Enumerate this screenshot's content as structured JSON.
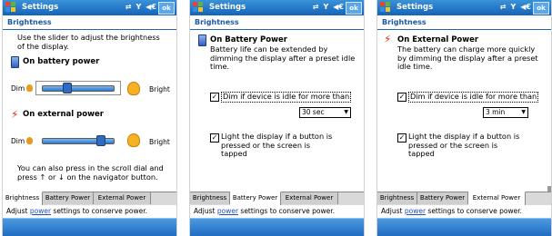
{
  "screens": [
    {
      "title": "Settings",
      "ok_label": "ok",
      "status_icons": [
        "⇄",
        "Y",
        "◀€"
      ],
      "page_heading": "Brightness",
      "instruction": "Use the slider to adjust the brightness of the display.",
      "battery_label": "On battery power",
      "external_label": "On external power",
      "dim_label": "Dim",
      "bright_label": "Bright",
      "battery_level": 0.33,
      "external_level": 0.85,
      "bottom_text": "You can also press in the scroll dial and press ↑ or ↓ on the navigator button.",
      "tabs": [
        "Brightness",
        "Battery Power",
        "External Power"
      ],
      "active_tab": 0,
      "footer_prefix": "Adjust ",
      "footer_link": "power",
      "footer_suffix": " settings to conserve power."
    },
    {
      "title": "Settings",
      "ok_label": "ok",
      "status_icons": [
        "⇄",
        "Y",
        "◀€"
      ],
      "page_heading": "Brightness",
      "section_title": "On Battery Power",
      "description": "Battery life can be extended by dimming the display after a preset idle time.",
      "dim_check_label": "Dim if device is idle for more than",
      "dim_checked": true,
      "timeout_value": "30 sec",
      "light_check_label": "Light the display if a button is pressed  or the screen is tapped",
      "light_checked": true,
      "tabs": [
        "Brightness",
        "Battery Power",
        "External Power"
      ],
      "active_tab": 1,
      "footer_prefix": "Adjust ",
      "footer_link": "power",
      "footer_suffix": " settings to conserve power."
    },
    {
      "title": "Settings",
      "ok_label": "ok",
      "status_icons": [
        "⇄",
        "Y",
        "◀€"
      ],
      "page_heading": "Brightness",
      "section_title": "On External Power",
      "description": "The battery can charge more quickly by dimming the display after a preset idle time.",
      "dim_check_label": "Dim if device is idle for more than",
      "dim_checked": true,
      "timeout_value": "3 min",
      "light_check_label": "Light the display if a button is pressed  or the screen is tapped",
      "light_checked": true,
      "tabs": [
        "Brightness",
        "Battery Power",
        "External Power"
      ],
      "active_tab": 2,
      "footer_prefix": "Adjust ",
      "footer_link": "power",
      "footer_suffix": " settings to conserve power."
    }
  ],
  "check_mark": "✓",
  "dropdown_arrow": "▼",
  "icons": {
    "start": "windows-flag-icon",
    "battery": "battery-icon",
    "external_power": "lightning-bolt-icon",
    "dim": "dim-bulb-icon",
    "bright": "bright-bulb-icon"
  }
}
